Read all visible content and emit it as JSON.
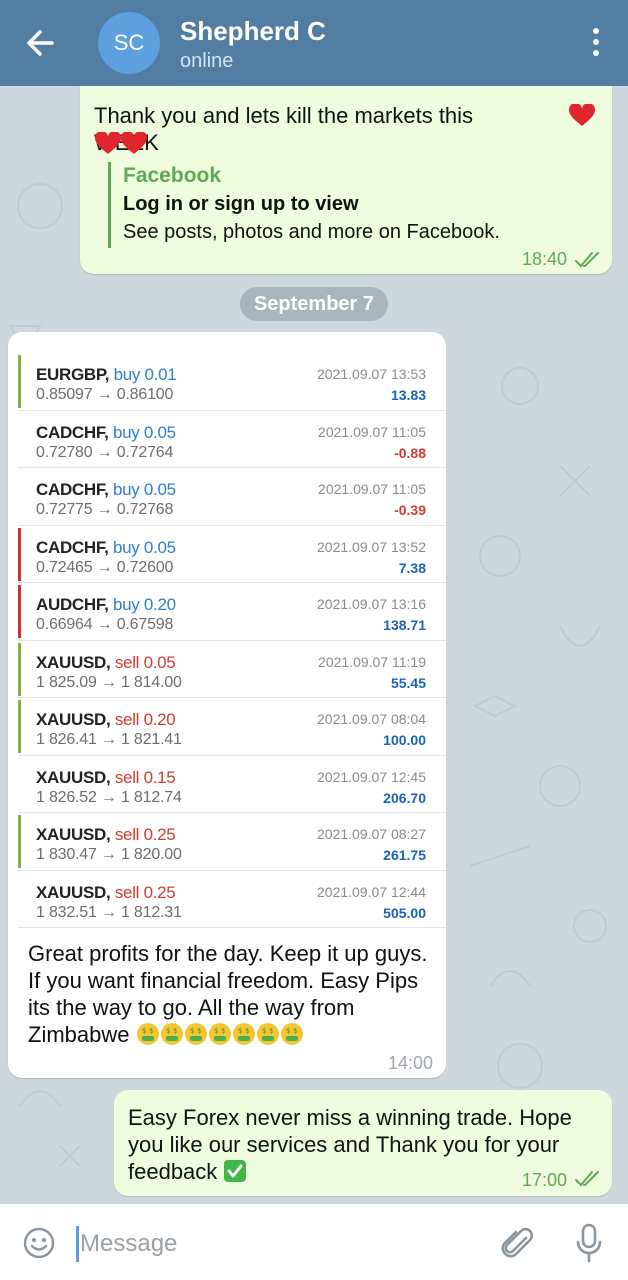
{
  "header": {
    "avatar_initials": "SC",
    "contact_name": "Shepherd C",
    "status": "online"
  },
  "messages": {
    "m1": {
      "text_line1": "Thank you and lets kill the markets this WEEK",
      "link_site": "Facebook",
      "link_title": "Log in or sign up to view",
      "link_desc": "See posts, photos and more on Facebook.",
      "time": "18:40"
    },
    "date_separator": "September 7",
    "m2": {
      "trades": [
        {
          "pair": "EURGBP,",
          "side": "buy",
          "vol": "0.01",
          "open": "0.85097",
          "close": "0.86100",
          "time": "2021.09.07 13:53",
          "profit": "13.83",
          "bar": "green"
        },
        {
          "pair": "CADCHF,",
          "side": "buy",
          "vol": "0.05",
          "open": "0.72780",
          "close": "0.72764",
          "time": "2021.09.07 11:05",
          "profit": "-0.88",
          "bar": "none"
        },
        {
          "pair": "CADCHF,",
          "side": "buy",
          "vol": "0.05",
          "open": "0.72775",
          "close": "0.72768",
          "time": "2021.09.07 11:05",
          "profit": "-0.39",
          "bar": "none"
        },
        {
          "pair": "CADCHF,",
          "side": "buy",
          "vol": "0.05",
          "open": "0.72465",
          "close": "0.72600",
          "time": "2021.09.07 13:52",
          "profit": "7.38",
          "bar": "red"
        },
        {
          "pair": "AUDCHF,",
          "side": "buy",
          "vol": "0.20",
          "open": "0.66964",
          "close": "0.67598",
          "time": "2021.09.07 13:16",
          "profit": "138.71",
          "bar": "red"
        },
        {
          "pair": "XAUUSD,",
          "side": "sell",
          "vol": "0.05",
          "open": "1 825.09",
          "close": "1 814.00",
          "time": "2021.09.07 11:19",
          "profit": "55.45",
          "bar": "green"
        },
        {
          "pair": "XAUUSD,",
          "side": "sell",
          "vol": "0.20",
          "open": "1 826.41",
          "close": "1 821.41",
          "time": "2021.09.07 08:04",
          "profit": "100.00",
          "bar": "green"
        },
        {
          "pair": "XAUUSD,",
          "side": "sell",
          "vol": "0.15",
          "open": "1 826.52",
          "close": "1 812.74",
          "time": "2021.09.07 12:45",
          "profit": "206.70",
          "bar": "none"
        },
        {
          "pair": "XAUUSD,",
          "side": "sell",
          "vol": "0.25",
          "open": "1 830.47",
          "close": "1 820.00",
          "time": "2021.09.07 08:27",
          "profit": "261.75",
          "bar": "green"
        },
        {
          "pair": "XAUUSD,",
          "side": "sell",
          "vol": "0.25",
          "open": "1 832.51",
          "close": "1 812.31",
          "time": "2021.09.07 12:44",
          "profit": "505.00",
          "bar": "none"
        }
      ],
      "caption": "Great profits for the day. Keep it up guys. If you want financial freedom. Easy Pips its the way to go. All the way from Zimbabwe",
      "time": "14:00"
    },
    "m3": {
      "text": "Easy Forex never miss a winning trade. Hope you like our services and Thank you for your feedback",
      "time": "17:00"
    }
  },
  "input": {
    "placeholder": "Message"
  },
  "colors": {
    "header": "#517da2",
    "outgoing_bubble": "#effdde",
    "incoming_bubble": "#ffffff",
    "buy": "#2d7fd0",
    "sell": "#d43a2f",
    "profit_positive": "#1a63b8",
    "profit_negative": "#d43a2f",
    "bar_green": "#7cb342",
    "bar_red": "#d32f2f"
  },
  "icons": [
    "back-arrow-icon",
    "more-vertical-icon",
    "heart-icon",
    "double-check-icon",
    "money-mouth-face-icon",
    "check-mark-button-icon",
    "emoji-icon",
    "paperclip-icon",
    "microphone-icon"
  ]
}
